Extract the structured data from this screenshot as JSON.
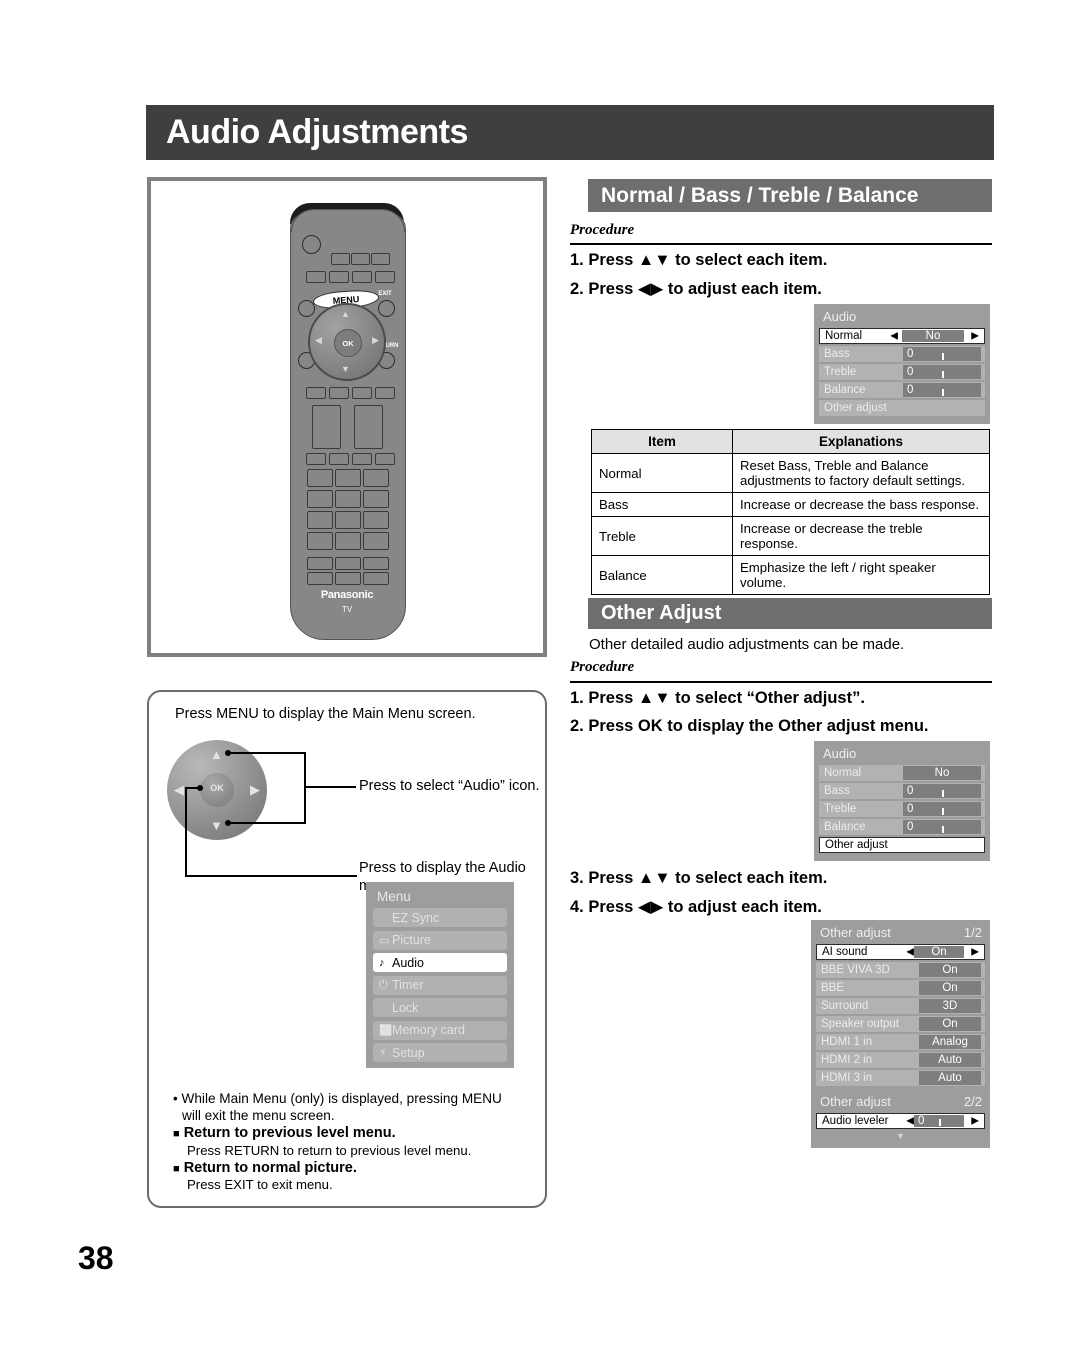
{
  "page": {
    "title": "Audio Adjustments",
    "number": "38"
  },
  "remote": {
    "menu_label": "MENU",
    "exit_label": "EXIT",
    "return_label": "RETURN",
    "ok_label": "OK",
    "brand": "Panasonic",
    "brand_sub": "TV"
  },
  "left": {
    "intro": "Press MENU to display the Main Menu screen.",
    "callout_up": "Press to select “Audio” icon.",
    "callout_ok_line1": "Press to display the Audio",
    "callout_ok_line2": "menu.",
    "nav_ok": "OK",
    "menu_osd": {
      "header": "Menu",
      "items": [
        {
          "icon": "",
          "label": "EZ Sync",
          "selected": false
        },
        {
          "icon": "▭",
          "label": "Picture",
          "selected": false
        },
        {
          "icon": "♪",
          "label": "Audio",
          "selected": true
        },
        {
          "icon": "⏻",
          "label": "Timer",
          "selected": false
        },
        {
          "icon": "\u0001",
          "label": "Lock",
          "selected": false
        },
        {
          "icon": "⬜",
          "label": "Memory card",
          "selected": false
        },
        {
          "icon": "⚡",
          "label": "Setup",
          "selected": false
        }
      ]
    },
    "notes": {
      "bullet_line1": "• While Main Menu (only) is displayed, pressing MENU",
      "bullet_line2": "will exit the menu screen.",
      "head1": "Return to previous level menu.",
      "sub1": "Press RETURN to return to previous level menu.",
      "head2": "Return to normal picture.",
      "sub2": "Press EXIT to exit menu."
    }
  },
  "right": {
    "section1": {
      "banner": "Normal / Bass / Treble / Balance",
      "procedure_label": "Procedure",
      "step1": "1.  Press ▲▼ to select each item.",
      "step2": "2.  Press ◀▶ to adjust each item.",
      "osd": {
        "header": "Audio",
        "rows": [
          {
            "label": "Normal",
            "kind": "choice",
            "value": "No",
            "selected": true
          },
          {
            "label": "Bass",
            "kind": "slider",
            "value": "0",
            "selected": false
          },
          {
            "label": "Treble",
            "kind": "slider",
            "value": "0",
            "selected": false
          },
          {
            "label": "Balance",
            "kind": "slider",
            "value": "0",
            "selected": false
          },
          {
            "label": "Other adjust",
            "kind": "plain",
            "value": "",
            "selected": false
          }
        ]
      },
      "table": {
        "headers": [
          "Item",
          "Explanations"
        ],
        "rows": [
          {
            "item": "Normal",
            "explanation": "Reset Bass, Treble and Balance\nadjustments to factory default settings."
          },
          {
            "item": "Bass",
            "explanation": "Increase or decrease the bass response."
          },
          {
            "item": "Treble",
            "explanation": "Increase or decrease the treble response."
          },
          {
            "item": "Balance",
            "explanation": "Emphasize the left / right speaker volume."
          }
        ]
      }
    },
    "section2": {
      "banner": "Other Adjust",
      "intro": "Other detailed audio adjustments can be made.",
      "procedure_label": "Procedure",
      "step1": "1.  Press ▲▼ to select “Other adjust”.",
      "step2": "2.  Press OK to display the Other adjust menu.",
      "step3": "3.  Press ▲▼ to select each item.",
      "step4": "4.  Press ◀▶ to adjust each item.",
      "osd_audio": {
        "header": "Audio",
        "rows": [
          {
            "label": "Normal",
            "kind": "choice",
            "value": "No",
            "selected": false
          },
          {
            "label": "Bass",
            "kind": "slider",
            "value": "0",
            "selected": false
          },
          {
            "label": "Treble",
            "kind": "slider",
            "value": "0",
            "selected": false
          },
          {
            "label": "Balance",
            "kind": "slider",
            "value": "0",
            "selected": false
          },
          {
            "label": "Other adjust",
            "kind": "plain",
            "value": "",
            "selected": true
          }
        ]
      },
      "osd_other_1": {
        "header": "Other adjust",
        "page": "1/2",
        "rows": [
          {
            "label": "AI sound",
            "kind": "choice",
            "value": "On",
            "selected": true
          },
          {
            "label": "BBE VIVA 3D",
            "kind": "choice",
            "value": "On",
            "selected": false
          },
          {
            "label": "BBE",
            "kind": "choice",
            "value": "On",
            "selected": false
          },
          {
            "label": "Surround",
            "kind": "choice",
            "value": "3D",
            "selected": false
          },
          {
            "label": "Speaker output",
            "kind": "choice",
            "value": "On",
            "selected": false
          },
          {
            "label": "HDMI 1 in",
            "kind": "choice",
            "value": "Analog",
            "selected": false
          },
          {
            "label": "HDMI 2 in",
            "kind": "choice",
            "value": "Auto",
            "selected": false
          },
          {
            "label": "HDMI 3 in",
            "kind": "choice",
            "value": "Auto",
            "selected": false
          }
        ],
        "scroll": "▼"
      },
      "osd_other_2": {
        "header": "Other adjust",
        "page": "2/2",
        "rows": [
          {
            "label": "Audio leveler",
            "kind": "slider",
            "value": "0",
            "selected": true
          }
        ],
        "scroll": "▼"
      }
    }
  },
  "colors": {
    "banner_dark": "#3f3f3f",
    "banner_gray": "#6e6e6e",
    "osd_bg": "#9d9d9d",
    "osd_row": "#b2b2b2"
  }
}
